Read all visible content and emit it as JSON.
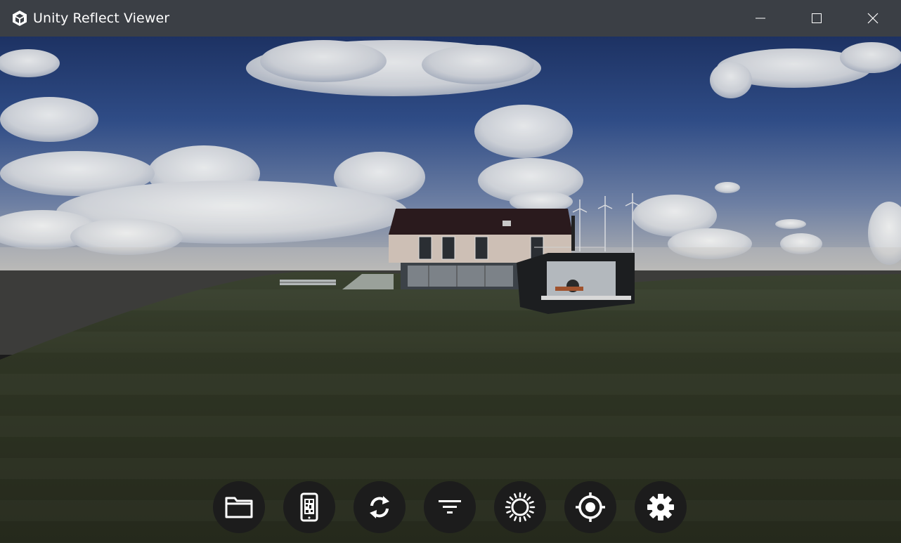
{
  "window": {
    "title": "Unity Reflect Viewer",
    "app_icon": "unity-logo-icon",
    "controls": [
      "minimize-icon",
      "maximize-icon",
      "close-icon"
    ]
  },
  "colors": {
    "titlebar_bg": "#3b3f45",
    "toolbar_button_bg": "#1c1c1c",
    "icon_color": "#ffffff",
    "sky_top": "#1f3566",
    "grass": "#2d3320"
  },
  "toolbar": {
    "buttons": [
      {
        "name": "open-project-button",
        "icon": "folder-icon"
      },
      {
        "name": "qr-code-mobile-button",
        "icon": "phone-qr-icon"
      },
      {
        "name": "sync-button",
        "icon": "sync-icon"
      },
      {
        "name": "filter-button",
        "icon": "filter-icon"
      },
      {
        "name": "sun-study-button",
        "icon": "sun-icon"
      },
      {
        "name": "orbit-target-button",
        "icon": "target-icon"
      },
      {
        "name": "settings-button",
        "icon": "gear-icon"
      }
    ]
  }
}
